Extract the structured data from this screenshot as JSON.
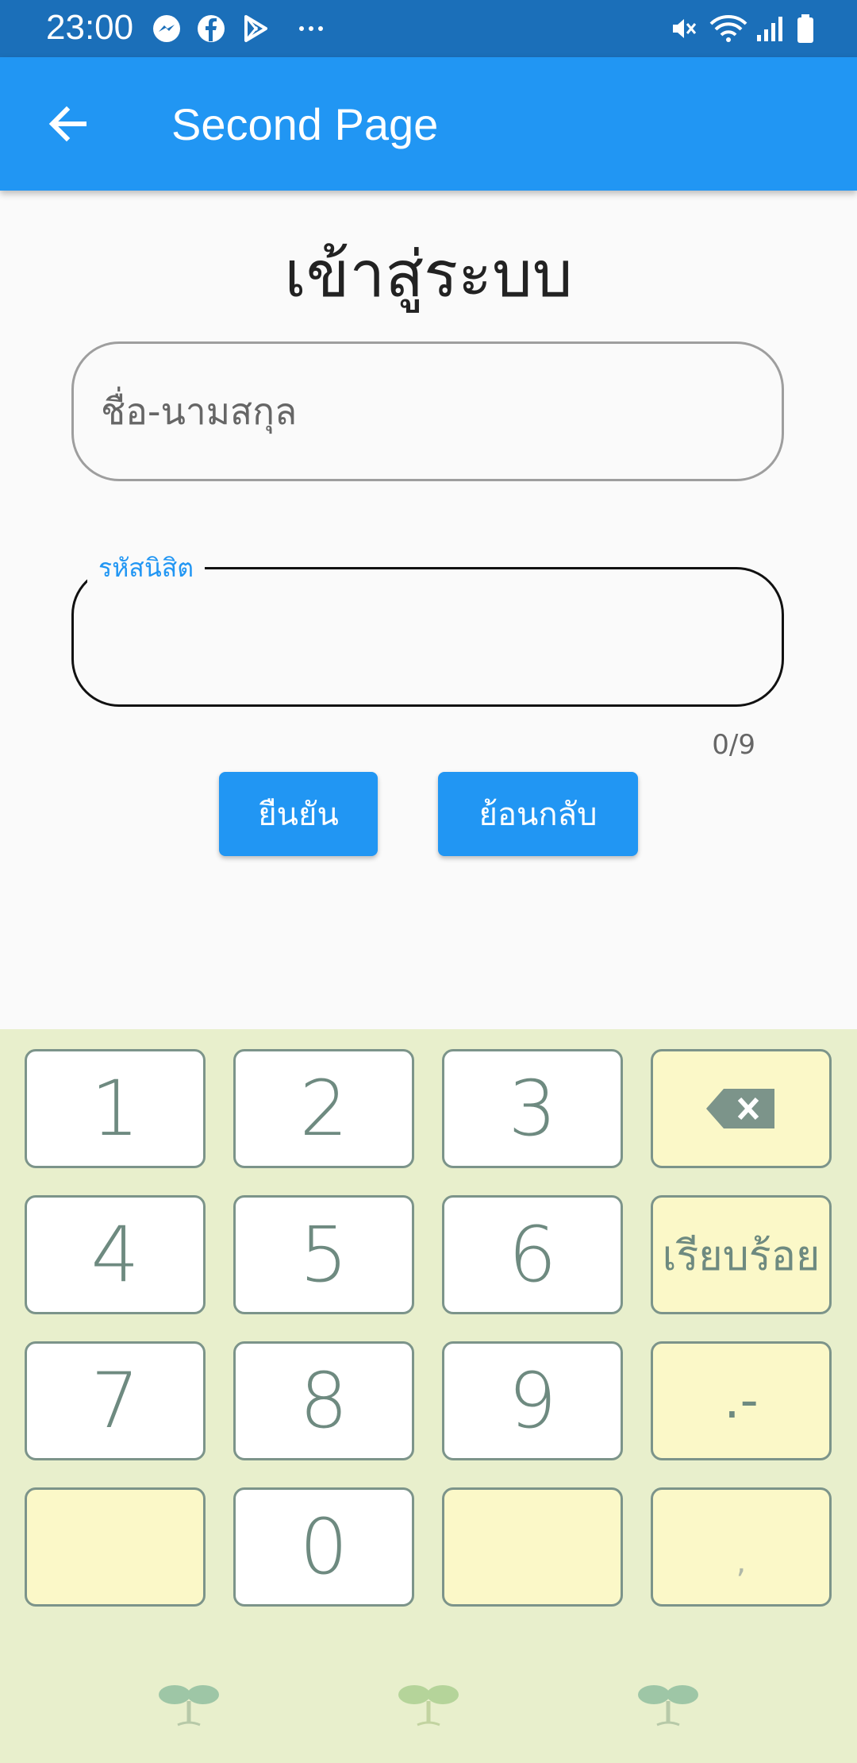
{
  "status_bar": {
    "time": "23:00"
  },
  "app_bar": {
    "title": "Second Page"
  },
  "page": {
    "title": "เข้าสู่ระบบ",
    "name_field": {
      "placeholder": "ชื่อ-นามสกุล",
      "value": ""
    },
    "id_field": {
      "label": "รหัสนิสิต",
      "value": "",
      "counter": "0/9"
    },
    "buttons": {
      "confirm": "ยืนยัน",
      "back": "ย้อนกลับ"
    }
  },
  "keyboard": {
    "keys": [
      "1",
      "2",
      "3",
      "4",
      "5",
      "6",
      "7",
      "8",
      "9",
      "0"
    ],
    "done": "เรียบร้อย",
    "dot_dash": ".-",
    "comma": ","
  },
  "colors": {
    "primary": "#2196f3",
    "status_bar": "#1b6fb9",
    "keyboard_bg": "#e8efcc",
    "key_yellow": "#fbf8c8"
  }
}
